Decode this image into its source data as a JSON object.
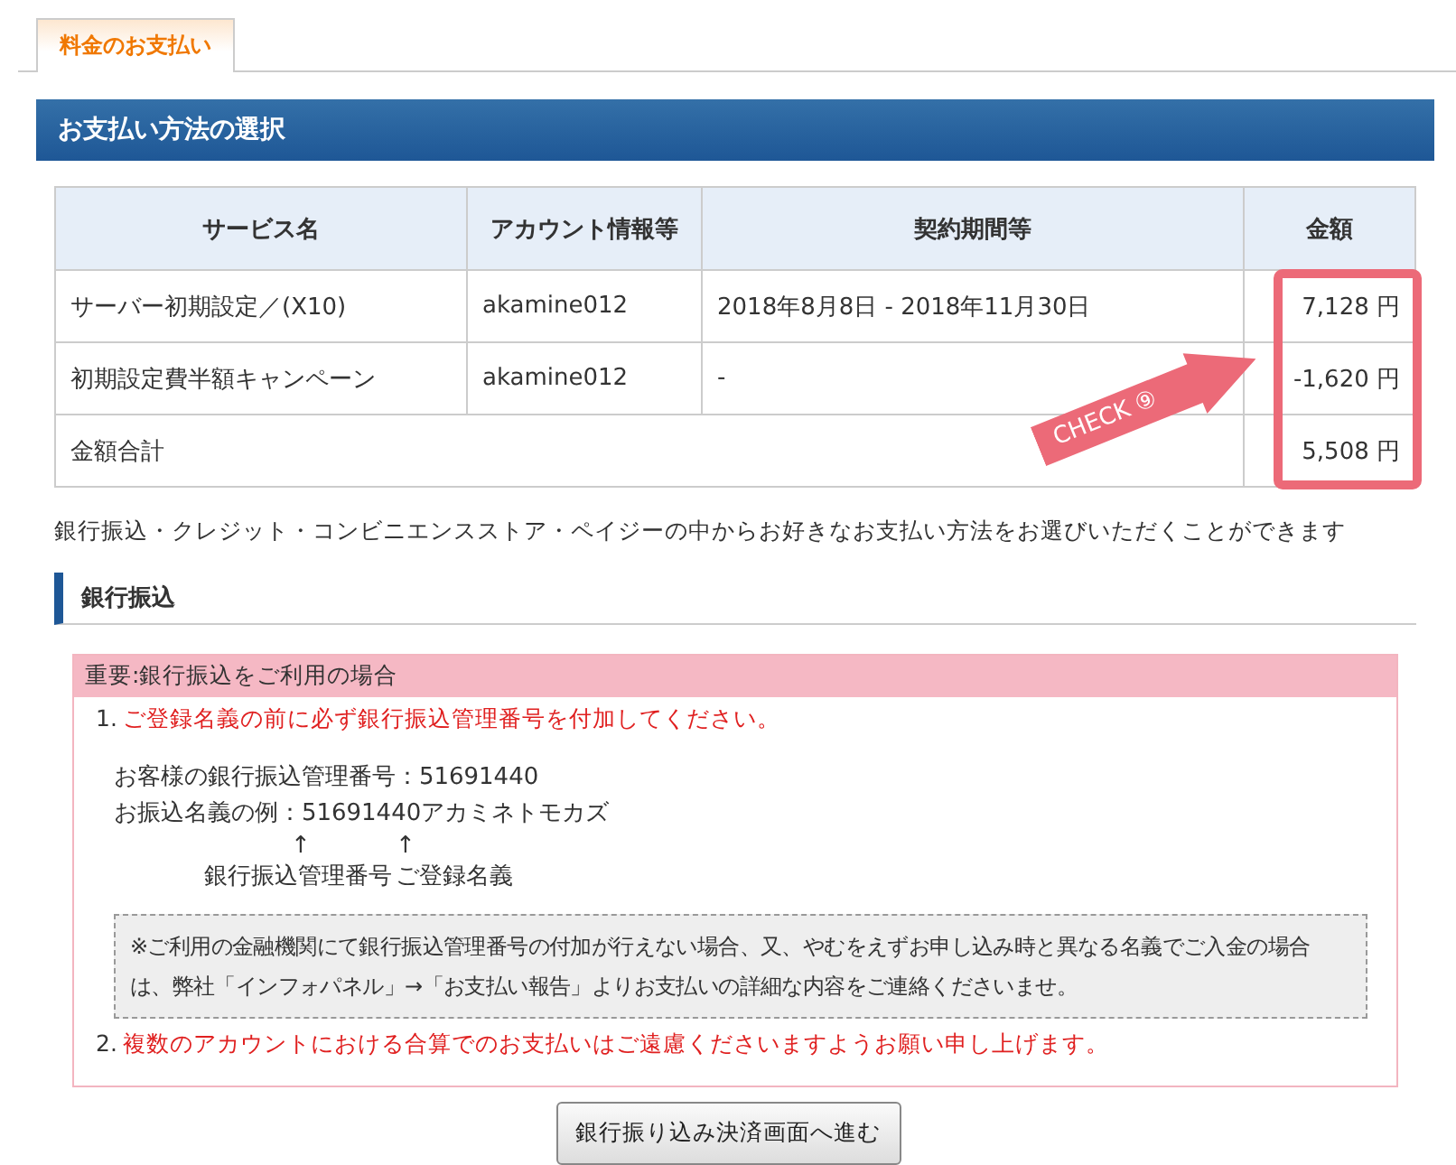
{
  "tabs": [
    {
      "label": "料金のお支払い",
      "selected": true
    }
  ],
  "section_title": "お支払い方法の選択",
  "table": {
    "columns": [
      "サービス名",
      "アカウント情報等",
      "契約期間等",
      "金額"
    ],
    "rows": [
      {
        "kind": "item",
        "cells": [
          "サーバー初期設定／(X10)",
          "akamine012",
          "2018年8月8日 - 2018年11月30日",
          "7,128 円"
        ]
      },
      {
        "kind": "item",
        "cells": [
          "初期設定費半額キャンペーン",
          "akamine012",
          "-",
          "-1,620 円"
        ]
      }
    ],
    "total": {
      "label": "金額合計",
      "amount": "5,508 円"
    }
  },
  "annotation": {
    "label": "CHECK ⑨"
  },
  "intro": "銀行振込・クレジット・コンビニエンスストア・ペイジーの中からお好きなお支払い方法をお選びいただくことができます",
  "bank_transfer": {
    "heading": "銀行振込",
    "notice_title": "重要:銀行振込をご利用の場合",
    "items": [
      {
        "number": "1.",
        "text": "ご登録名義の前に必ず銀行振込管理番号を付加してください。",
        "lines": [
          "お客様の銀行振込管理番号：51691440",
          "お振込名義の例：51691440アカミネトモカズ"
        ],
        "pointers": [
          {
            "arrow": "↑",
            "label": "銀行振込管理番号"
          },
          {
            "arrow": "↑",
            "label": "ご登録名義"
          }
        ],
        "note": "※ご利用の金融機関にて銀行振込管理番号の付加が行えない場合、又、やむをえずお申し込み時と異なる名義でご入金の場合は、弊社「インフォパネル」→「お支払い報告」よりお支払いの詳細な内容をご連絡くださいませ。"
      },
      {
        "number": "2.",
        "text": "複数のアカウントにおける合算でのお支払いはご遠慮くださいますようお願い申し上げます。"
      }
    ],
    "button": "銀行振り込み決済画面へ進む"
  }
}
